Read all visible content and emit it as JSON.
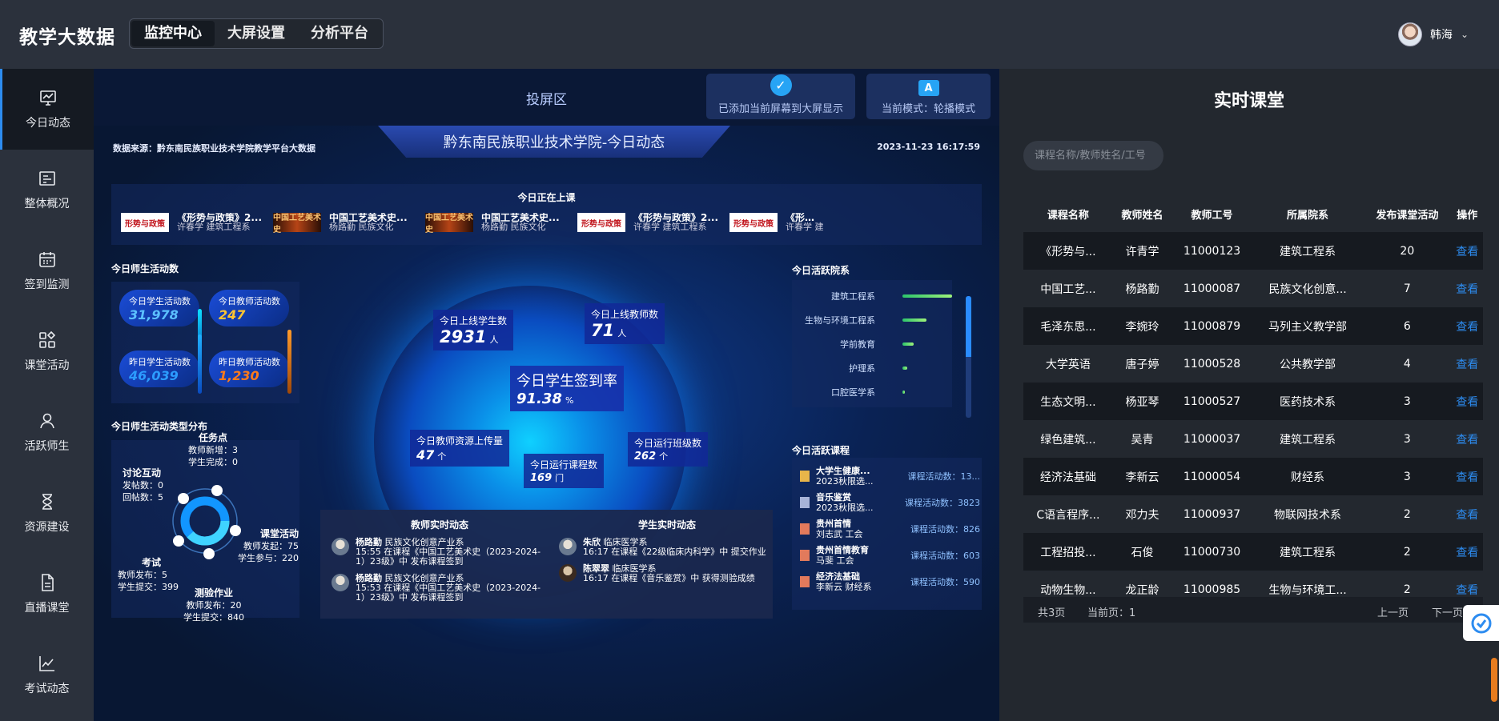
{
  "app": {
    "title": "教学大数据"
  },
  "top_nav": [
    {
      "label": "监控中心",
      "active": true
    },
    {
      "label": "大屏设置",
      "active": false
    },
    {
      "label": "分析平台",
      "active": false
    }
  ],
  "user": {
    "name": "韩海"
  },
  "sidebar": [
    {
      "label": "今日动态",
      "icon": "monitor-chart-icon",
      "active": true
    },
    {
      "label": "整体概况",
      "icon": "overview-card-icon"
    },
    {
      "label": "签到监测",
      "icon": "calendar-icon"
    },
    {
      "label": "课堂活动",
      "icon": "grid-shapes-icon"
    },
    {
      "label": "活跃师生",
      "icon": "user-icon"
    },
    {
      "label": "资源建设",
      "icon": "hourglass-icon"
    },
    {
      "label": "直播课堂",
      "icon": "document-icon"
    },
    {
      "label": "考试动态",
      "icon": "line-chart-icon"
    }
  ],
  "projection": {
    "label": "投屏区",
    "added_status": "已添加当前屏幕到大屏显示",
    "mode_status": "当前模式：轮播模式"
  },
  "dashboard": {
    "banner": "黔东南民族职业技术学院-今日动态",
    "source": "数据来源：黔东南民族职业技术学院教学平台大数据",
    "datetime": "2023-11-23 16:17:59",
    "now_in_class": {
      "title": "今日正在上课",
      "courses": [
        {
          "thumb": "形势与政策",
          "thumb_style": "red",
          "name": "《形势与政策》2...",
          "sub": "许春学  建筑工程系"
        },
        {
          "thumb": "中国工艺美术史",
          "thumb_style": "dark",
          "name": "中国工艺美术史...",
          "sub": "杨路勤  民族文化"
        },
        {
          "thumb": "中国工艺美术史",
          "thumb_style": "dark",
          "name": "中国工艺美术史...",
          "sub": "杨路勤  民族文化"
        },
        {
          "thumb": "形势与政策",
          "thumb_style": "red",
          "name": "《形势与政策》2...",
          "sub": "许春学  建筑工程系"
        },
        {
          "thumb": "形势与政策",
          "thumb_style": "red",
          "name": "《形势与政",
          "sub": "许春学  建"
        }
      ]
    },
    "activity_count": {
      "title": "今日师生活动数",
      "today_student_label": "今日学生活动数",
      "today_student": "31,978",
      "today_teacher_label": "今日教师活动数",
      "today_teacher": "247",
      "yesterday_student_label": "昨日学生活动数",
      "yesterday_student": "46,039",
      "yesterday_teacher_label": "昨日教师活动数",
      "yesterday_teacher": "1,230"
    },
    "activity_types": {
      "title": "今日师生活动类型分布",
      "task": {
        "name": "任务点",
        "l1": "教师新增：3",
        "l2": "学生完成：0"
      },
      "discussion": {
        "name": "讨论互动",
        "l1": "发帖数：0",
        "l2": "回帖数：5"
      },
      "classroom": {
        "name": "课堂活动",
        "l1": "教师发起：75",
        "l2": "学生参与：220"
      },
      "exam": {
        "name": "考试",
        "l1": "教师发布：5",
        "l2": "学生提交：399"
      },
      "homework": {
        "name": "测验作业",
        "l1": "教师发布：20",
        "l2": "学生提交：840"
      }
    },
    "metrics": {
      "online_students_label": "今日上线学生数",
      "online_students": "2931",
      "online_students_unit": "人",
      "online_teachers_label": "今日上线教师数",
      "online_teachers": "71",
      "online_teachers_unit": "人",
      "signin_rate_label": "今日学生签到率",
      "signin_rate": "91.38",
      "signin_rate_unit": "%",
      "resources_label": "今日教师资源上传量",
      "resources": "47",
      "resources_unit": "个",
      "running_courses_label": "今日运行课程数",
      "running_courses": "169",
      "running_courses_unit": "门",
      "running_classes_label": "今日运行班级数",
      "running_classes": "262",
      "running_classes_unit": "个"
    },
    "active_depts": {
      "title": "今日活跃院系",
      "items": [
        {
          "name": "建筑工程系",
          "value": 1.0
        },
        {
          "name": "生物与环境工程系",
          "value": 0.48
        },
        {
          "name": "学前教育",
          "value": 0.22
        },
        {
          "name": "护理系",
          "value": 0.1
        },
        {
          "name": "口腔医学系",
          "value": 0.04
        }
      ]
    },
    "active_courses": {
      "title": "今日活跃课程",
      "items": [
        {
          "name": "大学生健康...",
          "sub": "2023秋限选...",
          "count": "课程活动数：13...",
          "icon_color": "#e8b54a"
        },
        {
          "name": "音乐鉴赏",
          "sub": "2023秋限选...",
          "count": "课程活动数：3823",
          "icon_color": "#a8b4d8"
        },
        {
          "name": "贵州首情",
          "sub": "刘志武  工会",
          "count": "课程活动数：826",
          "icon_color": "#e27a5c"
        },
        {
          "name": "贵州首情教育",
          "sub": "马斐  工会",
          "count": "课程活动数：603",
          "icon_color": "#e27a5c"
        },
        {
          "name": "经济法基础",
          "sub": "李新云  财经系",
          "count": "课程活动数：590",
          "icon_color": "#e27a5c"
        }
      ]
    },
    "teacher_feed": {
      "title": "教师实时动态",
      "items": [
        {
          "who": "杨路勤",
          "dept": "民族文化创意产业系",
          "line": "15:55 在课程《中国工艺美术史（2023-2024-1）23级》中 发布课程签到"
        },
        {
          "who": "杨路勤",
          "dept": "民族文化创意产业系",
          "line": "15:53 在课程《中国工艺美术史（2023-2024-1）23级》中 发布课程签到"
        }
      ]
    },
    "student_feed": {
      "title": "学生实时动态",
      "items": [
        {
          "who": "朱欣",
          "dept": "临床医学系",
          "line": "16:17 在课程《22级临床内科学》中 提交作业"
        },
        {
          "who": "陈翠翠",
          "dept": "临床医学系",
          "line": "16:17 在课程《音乐鉴赏》中 获得测验成绩"
        }
      ]
    }
  },
  "realtime": {
    "title": "实时课堂",
    "search_placeholder": "课程名称/教师姓名/工号",
    "columns": [
      "课程名称",
      "教师姓名",
      "教师工号",
      "所属院系",
      "发布课堂活动",
      "操作"
    ],
    "rows": [
      [
        "《形势与...",
        "许青学",
        "11000123",
        "建筑工程系",
        "20",
        "查看"
      ],
      [
        "中国工艺...",
        "杨路勤",
        "11000087",
        "民族文化创意...",
        "7",
        "查看"
      ],
      [
        "毛泽东思...",
        "李婉玲",
        "11000879",
        "马列主义教学部",
        "6",
        "查看"
      ],
      [
        "大学英语",
        "唐子婷",
        "11000528",
        "公共教学部",
        "4",
        "查看"
      ],
      [
        "生态文明...",
        "杨亚琴",
        "11000527",
        "医药技术系",
        "3",
        "查看"
      ],
      [
        "绿色建筑...",
        "吴青",
        "11000037",
        "建筑工程系",
        "3",
        "查看"
      ],
      [
        "经济法基础",
        "李新云",
        "11000054",
        "财经系",
        "3",
        "查看"
      ],
      [
        "C语言程序...",
        "邓力夫",
        "11000937",
        "物联网技术系",
        "2",
        "查看"
      ],
      [
        "工程招投...",
        "石俊",
        "11000730",
        "建筑工程系",
        "2",
        "查看"
      ],
      [
        "动物生物...",
        "龙正龄",
        "11000985",
        "生物与环境工...",
        "2",
        "查看"
      ]
    ],
    "pager": {
      "total": "共3页",
      "current": "当前页：1",
      "prev": "上一页",
      "next": "下一页"
    }
  },
  "colors": {
    "accent": "#2d8cf0",
    "sidebar_bg": "#2b313c",
    "screen_bg": "#0a1836"
  }
}
